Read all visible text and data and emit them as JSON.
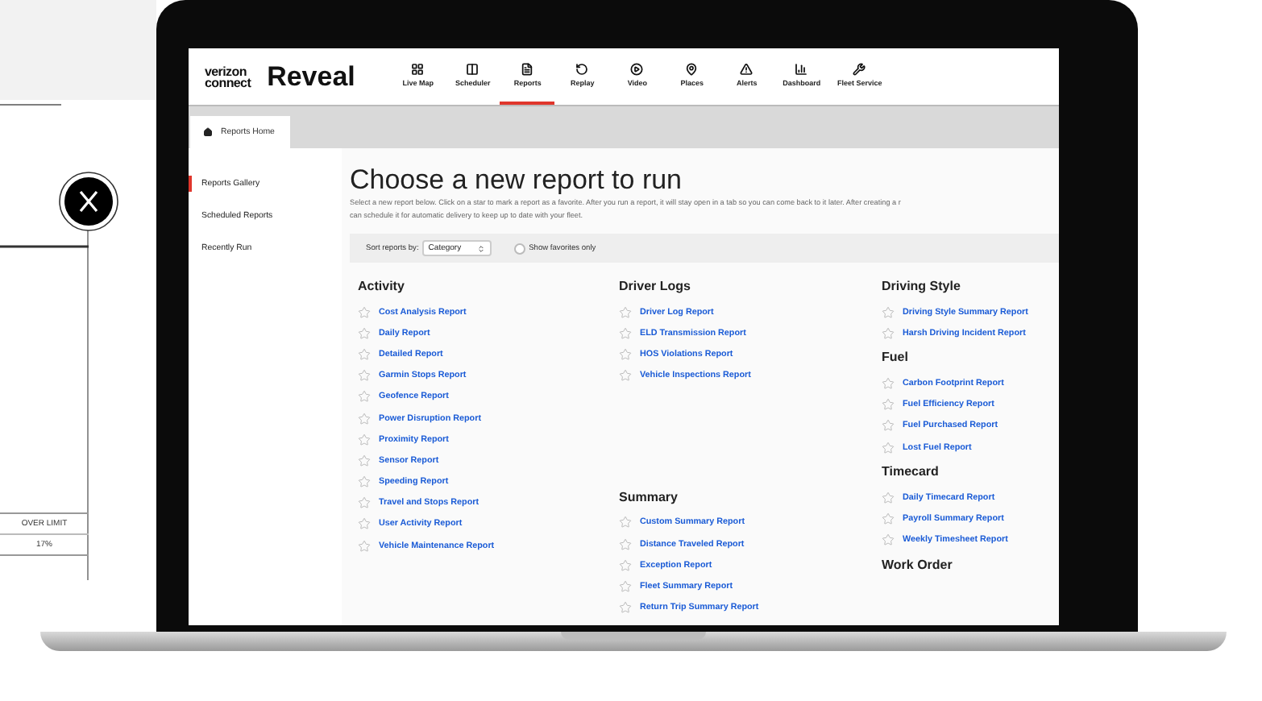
{
  "backdrop": {
    "table_header": "OVER LIMIT",
    "table_value": "17%"
  },
  "app": {
    "logo_lines": [
      "verizon",
      "connect"
    ],
    "product": "Reveal"
  },
  "nav": [
    {
      "label": "Live Map",
      "selected": false
    },
    {
      "label": "Scheduler",
      "selected": false
    },
    {
      "label": "Reports",
      "selected": true
    },
    {
      "label": "Replay",
      "selected": false
    },
    {
      "label": "Video",
      "selected": false
    },
    {
      "label": "Places",
      "selected": false
    },
    {
      "label": "Alerts",
      "selected": false
    },
    {
      "label": "Dashboard",
      "selected": false
    },
    {
      "label": "Fleet Service",
      "selected": false
    }
  ],
  "tab": {
    "label": "Reports Home"
  },
  "sidebar": [
    {
      "label": "Reports Gallery",
      "selected": true
    },
    {
      "label": "Scheduled Reports",
      "selected": false
    },
    {
      "label": "Recently Run",
      "selected": false
    }
  ],
  "page": {
    "title": "Choose a new report to run",
    "description_lines": [
      "Select a new report below. Click on a star to mark a report as a favorite. After you run a report, it will stay open in a tab so you can come back to it later. After creating a r",
      "can schedule it for automatic delivery to keep up to date with your fleet."
    ]
  },
  "sort": {
    "label": "Sort reports by:",
    "value": "Category"
  },
  "favorites_filter": {
    "label": "Show favorites only",
    "checked": false
  },
  "report_columns": [
    [
      {
        "title": "Activity",
        "reports": [
          {
            "name": "Cost Analysis Report",
            "starred": false
          },
          {
            "name": "Daily Report",
            "starred": false
          },
          {
            "name": "Detailed Report",
            "starred": false
          },
          {
            "name": "Garmin Stops Report",
            "starred": false
          },
          {
            "name": "Geofence Report",
            "starred": false
          },
          {
            "name": "Power Disruption Report",
            "starred": false
          },
          {
            "name": "Proximity Report",
            "starred": false
          },
          {
            "name": "Sensor Report",
            "starred": false
          },
          {
            "name": "Speeding Report",
            "starred": false
          },
          {
            "name": "Travel and Stops Report",
            "starred": false
          },
          {
            "name": "User Activity Report",
            "starred": false
          },
          {
            "name": "Vehicle Maintenance Report",
            "starred": false
          }
        ]
      }
    ],
    [
      {
        "title": "Driver Logs",
        "reports": [
          {
            "name": "Driver Log Report",
            "starred": false
          },
          {
            "name": "ELD Transmission Report",
            "starred": false
          },
          {
            "name": "HOS Violations Report",
            "starred": false
          },
          {
            "name": "Vehicle Inspections Report",
            "starred": false
          }
        ]
      },
      {
        "title": "Summary",
        "reports": [
          {
            "name": "Custom Summary Report",
            "starred": false
          },
          {
            "name": "Distance Traveled Report",
            "starred": false
          },
          {
            "name": "Exception Report",
            "starred": false
          },
          {
            "name": "Fleet Summary Report",
            "starred": false
          },
          {
            "name": "Return Trip Summary Report",
            "starred": false
          }
        ]
      }
    ],
    [
      {
        "title": "Driving Style",
        "reports": [
          {
            "name": "Driving Style Summary Report",
            "starred": false
          },
          {
            "name": "Harsh Driving Incident Report",
            "starred": false
          }
        ]
      },
      {
        "title": "Fuel",
        "reports": [
          {
            "name": "Carbon Footprint Report",
            "starred": false
          },
          {
            "name": "Fuel Efficiency Report",
            "starred": false
          },
          {
            "name": "Fuel Purchased Report",
            "starred": false
          },
          {
            "name": "Lost Fuel Report",
            "starred": false
          }
        ]
      },
      {
        "title": "Timecard",
        "reports": [
          {
            "name": "Daily Timecard Report",
            "starred": false
          },
          {
            "name": "Payroll Summary Report",
            "starred": false
          },
          {
            "name": "Weekly Timesheet Report",
            "starred": false
          }
        ]
      },
      {
        "title": "Work Order"
      }
    ]
  ]
}
